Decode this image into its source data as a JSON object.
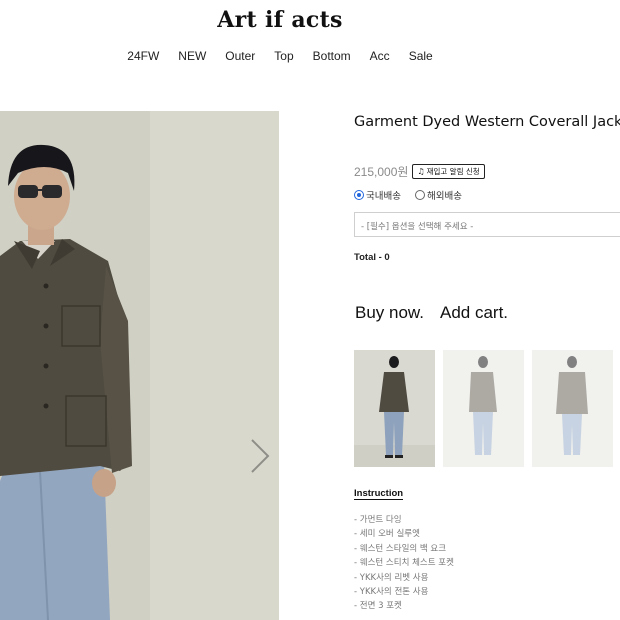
{
  "brand": {
    "logo": "Art if acts"
  },
  "nav": [
    "24FW",
    "NEW",
    "Outer",
    "Top",
    "Bottom",
    "Acc",
    "Sale"
  ],
  "product": {
    "title": "Garment Dyed Western Coverall Jacket_",
    "price": "215,000원",
    "restock_button": "재입고 알림 신청",
    "shipping": [
      {
        "label": "국내배송",
        "selected": true
      },
      {
        "label": "해외배송",
        "selected": false
      }
    ],
    "option_placeholder": "- [필수] 옵션을 선택해 주세요 -",
    "total": "Total - 0",
    "buy_now": "Buy now.",
    "add_cart": "Add cart."
  },
  "instruction": {
    "heading": "Instruction",
    "items": [
      "- 가먼트 다잉",
      "- 세미 오버 실루엣",
      "- 웨스턴 스타일의 백 요크",
      "- 웨스턴 스티치 체스트 포켓",
      "- YKK사의 리벳 사용",
      "- YKK사의 전톤 사용",
      "- 전면 3 포켓"
    ]
  },
  "colors": {
    "accent_radio": "#2266dd",
    "jacket": "#4f4b40",
    "jeans": "#93a6bf",
    "backdrop": "#d2d2c6"
  },
  "icons": {
    "carousel_next": "chevron-right-icon",
    "restock_bell": "bell-icon"
  }
}
